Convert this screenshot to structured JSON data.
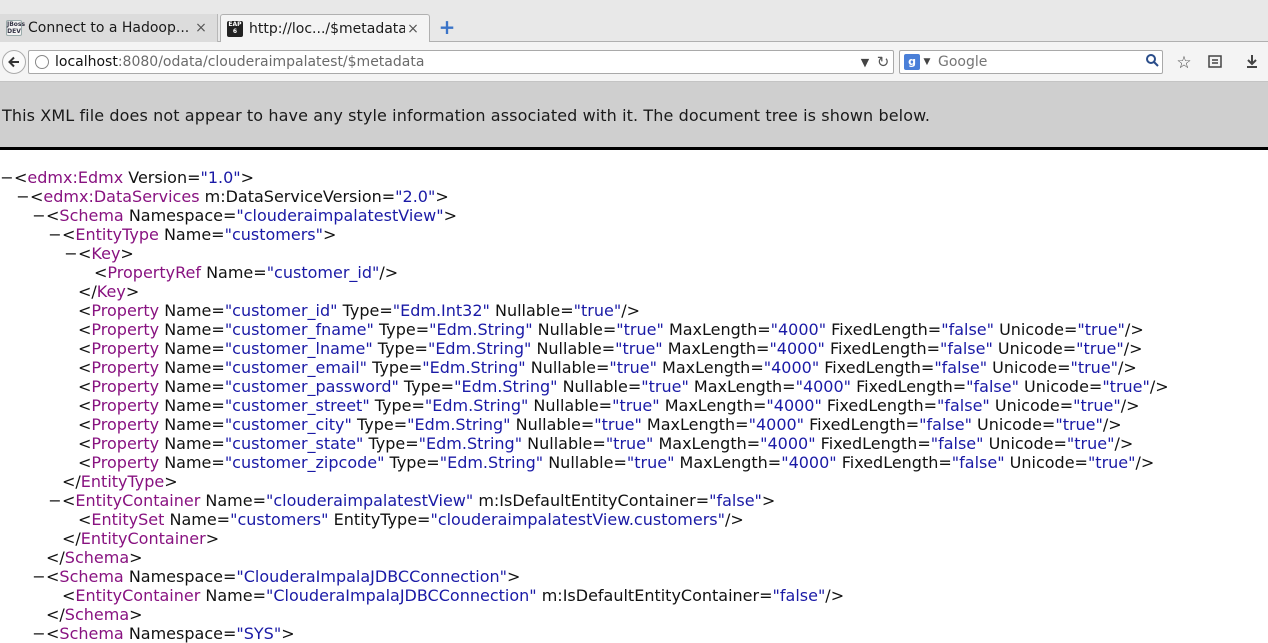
{
  "tabs": [
    {
      "favicon_text": "JBoss DEV",
      "title": "Connect to a Hadoop...",
      "close": "×"
    },
    {
      "favicon_text": "EAP 6",
      "title": "http://loc.../$metadata",
      "close": "×"
    }
  ],
  "new_tab": "+",
  "url": {
    "host": "localhost",
    "rest": ":8080/odata/clouderaimpalatest/$metadata"
  },
  "search": {
    "placeholder": "Google"
  },
  "info_message": "This XML file does not appear to have any style information associated with it. The document tree is shown below.",
  "xml_lines": [
    {
      "level": 0,
      "toggle": "−",
      "open": "<",
      "tag": "edmx:Edmx",
      "attrs": [
        {
          "n": "Version",
          "v": "1.0"
        }
      ],
      "end": ">"
    },
    {
      "level": 1,
      "toggle": "−",
      "open": "<",
      "tag": "edmx:DataServices",
      "attrs": [
        {
          "n": "m:DataServiceVersion",
          "v": "2.0"
        }
      ],
      "end": ">"
    },
    {
      "level": 2,
      "toggle": "−",
      "open": "<",
      "tag": "Schema",
      "attrs": [
        {
          "n": "Namespace",
          "v": "clouderaimpalatestView"
        }
      ],
      "end": ">"
    },
    {
      "level": 3,
      "toggle": "−",
      "open": "<",
      "tag": "EntityType",
      "attrs": [
        {
          "n": "Name",
          "v": "customers"
        }
      ],
      "end": ">"
    },
    {
      "level": 4,
      "toggle": "−",
      "open": "<",
      "tag": "Key",
      "attrs": [],
      "end": ">"
    },
    {
      "level": 5,
      "toggle": "",
      "open": "<",
      "tag": "PropertyRef",
      "attrs": [
        {
          "n": "Name",
          "v": "customer_id"
        }
      ],
      "end": "/>"
    },
    {
      "level": 4,
      "toggle": "",
      "open": "</",
      "tag": "Key",
      "attrs": [],
      "end": ">"
    },
    {
      "level": 4,
      "toggle": "",
      "open": "<",
      "tag": "Property",
      "attrs": [
        {
          "n": "Name",
          "v": "customer_id"
        },
        {
          "n": "Type",
          "v": "Edm.Int32"
        },
        {
          "n": "Nullable",
          "v": "true"
        }
      ],
      "end": "/>"
    },
    {
      "level": 4,
      "toggle": "",
      "open": "<",
      "tag": "Property",
      "attrs": [
        {
          "n": "Name",
          "v": "customer_fname"
        },
        {
          "n": "Type",
          "v": "Edm.String"
        },
        {
          "n": "Nullable",
          "v": "true"
        },
        {
          "n": "MaxLength",
          "v": "4000"
        },
        {
          "n": "FixedLength",
          "v": "false"
        },
        {
          "n": "Unicode",
          "v": "true"
        }
      ],
      "end": "/>"
    },
    {
      "level": 4,
      "toggle": "",
      "open": "<",
      "tag": "Property",
      "attrs": [
        {
          "n": "Name",
          "v": "customer_lname"
        },
        {
          "n": "Type",
          "v": "Edm.String"
        },
        {
          "n": "Nullable",
          "v": "true"
        },
        {
          "n": "MaxLength",
          "v": "4000"
        },
        {
          "n": "FixedLength",
          "v": "false"
        },
        {
          "n": "Unicode",
          "v": "true"
        }
      ],
      "end": "/>"
    },
    {
      "level": 4,
      "toggle": "",
      "open": "<",
      "tag": "Property",
      "attrs": [
        {
          "n": "Name",
          "v": "customer_email"
        },
        {
          "n": "Type",
          "v": "Edm.String"
        },
        {
          "n": "Nullable",
          "v": "true"
        },
        {
          "n": "MaxLength",
          "v": "4000"
        },
        {
          "n": "FixedLength",
          "v": "false"
        },
        {
          "n": "Unicode",
          "v": "true"
        }
      ],
      "end": "/>"
    },
    {
      "level": 4,
      "toggle": "",
      "open": "<",
      "tag": "Property",
      "attrs": [
        {
          "n": "Name",
          "v": "customer_password"
        },
        {
          "n": "Type",
          "v": "Edm.String"
        },
        {
          "n": "Nullable",
          "v": "true"
        },
        {
          "n": "MaxLength",
          "v": "4000"
        },
        {
          "n": "FixedLength",
          "v": "false"
        },
        {
          "n": "Unicode",
          "v": "true"
        }
      ],
      "end": "/>"
    },
    {
      "level": 4,
      "toggle": "",
      "open": "<",
      "tag": "Property",
      "attrs": [
        {
          "n": "Name",
          "v": "customer_street"
        },
        {
          "n": "Type",
          "v": "Edm.String"
        },
        {
          "n": "Nullable",
          "v": "true"
        },
        {
          "n": "MaxLength",
          "v": "4000"
        },
        {
          "n": "FixedLength",
          "v": "false"
        },
        {
          "n": "Unicode",
          "v": "true"
        }
      ],
      "end": "/>"
    },
    {
      "level": 4,
      "toggle": "",
      "open": "<",
      "tag": "Property",
      "attrs": [
        {
          "n": "Name",
          "v": "customer_city"
        },
        {
          "n": "Type",
          "v": "Edm.String"
        },
        {
          "n": "Nullable",
          "v": "true"
        },
        {
          "n": "MaxLength",
          "v": "4000"
        },
        {
          "n": "FixedLength",
          "v": "false"
        },
        {
          "n": "Unicode",
          "v": "true"
        }
      ],
      "end": "/>"
    },
    {
      "level": 4,
      "toggle": "",
      "open": "<",
      "tag": "Property",
      "attrs": [
        {
          "n": "Name",
          "v": "customer_state"
        },
        {
          "n": "Type",
          "v": "Edm.String"
        },
        {
          "n": "Nullable",
          "v": "true"
        },
        {
          "n": "MaxLength",
          "v": "4000"
        },
        {
          "n": "FixedLength",
          "v": "false"
        },
        {
          "n": "Unicode",
          "v": "true"
        }
      ],
      "end": "/>"
    },
    {
      "level": 4,
      "toggle": "",
      "open": "<",
      "tag": "Property",
      "attrs": [
        {
          "n": "Name",
          "v": "customer_zipcode"
        },
        {
          "n": "Type",
          "v": "Edm.String"
        },
        {
          "n": "Nullable",
          "v": "true"
        },
        {
          "n": "MaxLength",
          "v": "4000"
        },
        {
          "n": "FixedLength",
          "v": "false"
        },
        {
          "n": "Unicode",
          "v": "true"
        }
      ],
      "end": "/>"
    },
    {
      "level": 3,
      "toggle": "",
      "open": "</",
      "tag": "EntityType",
      "attrs": [],
      "end": ">"
    },
    {
      "level": 3,
      "toggle": "−",
      "open": "<",
      "tag": "EntityContainer",
      "attrs": [
        {
          "n": "Name",
          "v": "clouderaimpalatestView"
        },
        {
          "n": "m:IsDefaultEntityContainer",
          "v": "false"
        }
      ],
      "end": ">"
    },
    {
      "level": 4,
      "toggle": "",
      "open": "<",
      "tag": "EntitySet",
      "attrs": [
        {
          "n": "Name",
          "v": "customers"
        },
        {
          "n": "EntityType",
          "v": "clouderaimpalatestView.customers"
        }
      ],
      "end": "/>"
    },
    {
      "level": 3,
      "toggle": "",
      "open": "</",
      "tag": "EntityContainer",
      "attrs": [],
      "end": ">"
    },
    {
      "level": 2,
      "toggle": "",
      "open": "</",
      "tag": "Schema",
      "attrs": [],
      "end": ">"
    },
    {
      "level": 2,
      "toggle": "−",
      "open": "<",
      "tag": "Schema",
      "attrs": [
        {
          "n": "Namespace",
          "v": "ClouderaImpalaJDBCConnection"
        }
      ],
      "end": ">"
    },
    {
      "level": 3,
      "toggle": "",
      "open": "<",
      "tag": "EntityContainer",
      "attrs": [
        {
          "n": "Name",
          "v": "ClouderaImpalaJDBCConnection"
        },
        {
          "n": "m:IsDefaultEntityContainer",
          "v": "false"
        }
      ],
      "end": "/>"
    },
    {
      "level": 2,
      "toggle": "",
      "open": "</",
      "tag": "Schema",
      "attrs": [],
      "end": ">"
    },
    {
      "level": 2,
      "toggle": "−",
      "open": "<",
      "tag": "Schema",
      "attrs": [
        {
          "n": "Namespace",
          "v": "SYS"
        }
      ],
      "end": ">"
    }
  ]
}
